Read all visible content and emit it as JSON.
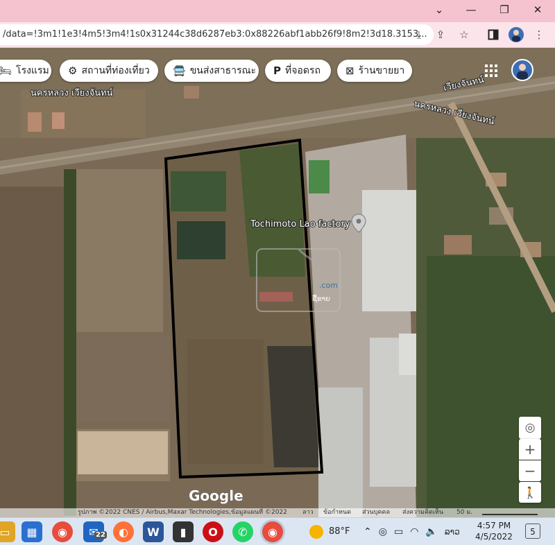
{
  "window": {
    "controls": {
      "minimize": "⌄",
      "minimize2": "—",
      "maximize": "❐",
      "close": "✕"
    }
  },
  "browser": {
    "url": "/data=!3m1!1e3!4m5!3m4!1s0x31244c38d6287eb3:0x88226abf1abb26f9!8m2!3d18.3153...",
    "icons": [
      "download-icon",
      "share-icon",
      "star-icon",
      "side-panel-icon",
      "profile-avatar",
      "menu-icon"
    ]
  },
  "map": {
    "chips": [
      {
        "icon": "hotel-icon",
        "glyph": "🛏",
        "label": "โรงแรม"
      },
      {
        "icon": "attraction-icon",
        "glyph": "⚙",
        "label": "สถานที่ท่องเที่ยว"
      },
      {
        "icon": "transit-icon",
        "glyph": "🚍",
        "label": "ขนส่งสาธารณะ"
      },
      {
        "icon": "parking-icon",
        "glyph": "P",
        "label": "ที่จอดรถ"
      },
      {
        "icon": "pharmacy-icon",
        "glyph": "⊠",
        "label": "ร้านขายยา"
      }
    ],
    "labels": {
      "city_left": "นครหลวง เวียงจันทน์",
      "city_right_top": "เวียงจันทน์",
      "city_right": "นครหลวง เวียงจันทน์",
      "place": "Tochimoto Lao factory",
      "watermark_site": ".com",
      "watermark_brand": "ຊື້ຂາຍ",
      "logo": "Google"
    },
    "controls": {
      "locate": "◎",
      "zoom_in": "+",
      "zoom_out": "−",
      "pegman": "🚶"
    },
    "attribution": "รูปภาพ ©2022 CNES / Airbus,Maxar Technologies,ข้อมูลแผนที่ ©2022",
    "footer_links": [
      "ลาว",
      "ข้อกำหนด",
      "ส่วนบุคคล",
      "ส่งความคิดเห็น"
    ],
    "scale": "50 ม."
  },
  "taskbar": {
    "apps": [
      {
        "name": "file-explorer",
        "glyph": "▭"
      },
      {
        "name": "microsoft-store",
        "glyph": "▦"
      },
      {
        "name": "chrome",
        "glyph": "◉"
      },
      {
        "name": "mail",
        "glyph": "✉",
        "badge": "22"
      },
      {
        "name": "firefox",
        "glyph": "◐"
      },
      {
        "name": "word",
        "glyph": "W"
      },
      {
        "name": "traffic-app",
        "glyph": "▮"
      },
      {
        "name": "opera",
        "glyph": "O"
      },
      {
        "name": "whatsapp",
        "glyph": "✆"
      },
      {
        "name": "chrome-active",
        "glyph": "◉"
      }
    ],
    "weather": "88°F",
    "language": "ລາວ",
    "time": "4:57 PM",
    "date": "4/5/2022",
    "notifications": "5"
  },
  "colors": {
    "titlebar": "#f5c3cf",
    "toolbar": "#fbe4ea",
    "taskbar": "#dce6f2",
    "outline": "#000000"
  }
}
